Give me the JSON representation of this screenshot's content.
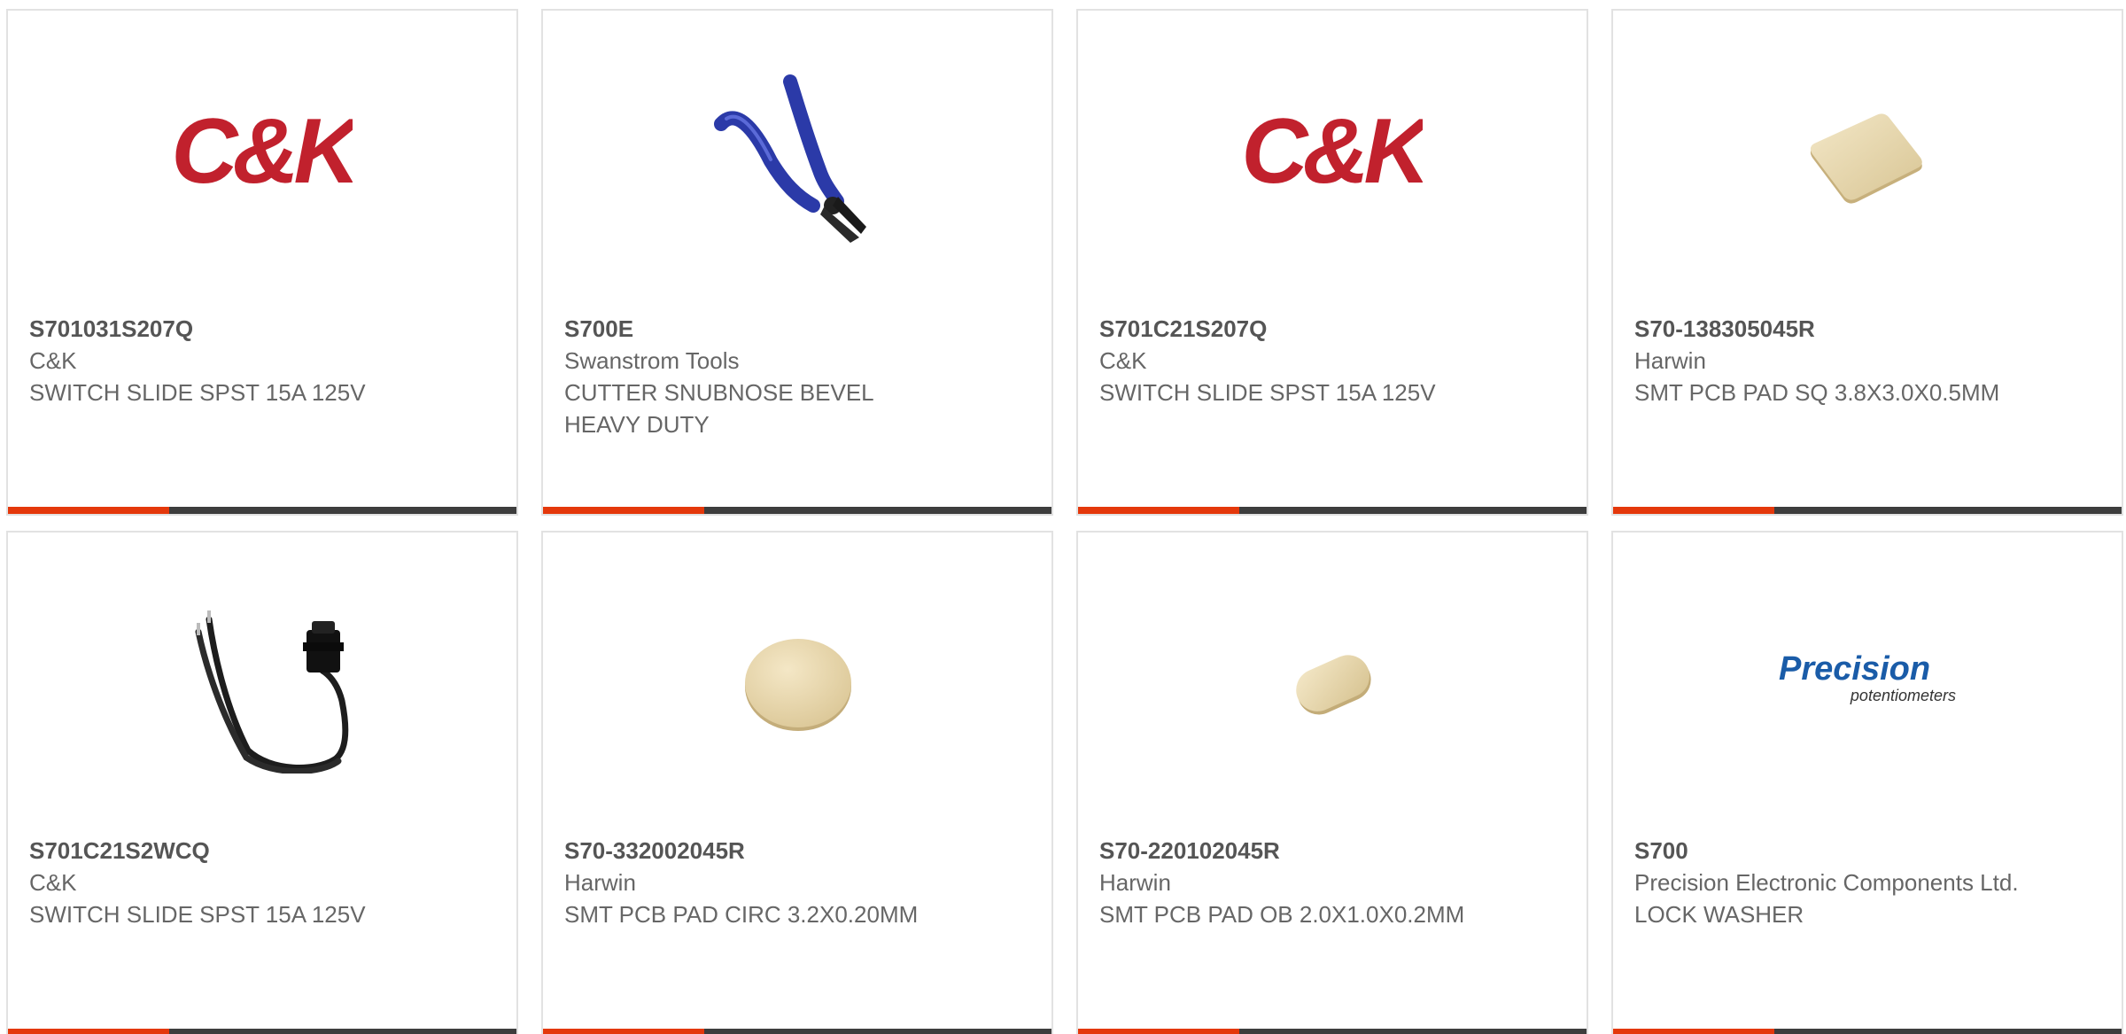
{
  "theme": {
    "accent": "#e4380b",
    "bar_dark": "#3d3d3d",
    "ck_red": "#c1212d",
    "precision_blue": "#1a5ca8"
  },
  "cards": [
    {
      "part_number": "S701031S207Q",
      "manufacturer": "C&K",
      "description": "SWITCH SLIDE SPST 15A 125V",
      "image_icon": "ck-logo-icon"
    },
    {
      "part_number": "S700E",
      "manufacturer": "Swanstrom Tools",
      "description": "CUTTER SNUBNOSE BEVEL HEAVY DUTY",
      "image_icon": "cutter-pliers-icon"
    },
    {
      "part_number": "S701C21S207Q",
      "manufacturer": "C&K",
      "description": "SWITCH SLIDE SPST 15A 125V",
      "image_icon": "ck-logo-icon"
    },
    {
      "part_number": "S70-138305045R",
      "manufacturer": "Harwin",
      "description": "SMT PCB PAD SQ 3.8X3.0X0.5MM",
      "image_icon": "square-pad-icon"
    },
    {
      "part_number": "S701C21S2WCQ",
      "manufacturer": "C&K",
      "description": "SWITCH SLIDE SPST 15A 125V",
      "image_icon": "wired-switch-icon"
    },
    {
      "part_number": "S70-332002045R",
      "manufacturer": "Harwin",
      "description": "SMT PCB PAD CIRC 3.2X0.20MM",
      "image_icon": "circular-pad-icon"
    },
    {
      "part_number": "S70-220102045R",
      "manufacturer": "Harwin",
      "description": "SMT PCB PAD OB 2.0X1.0X0.2MM",
      "image_icon": "oblong-pad-icon"
    },
    {
      "part_number": "S700",
      "manufacturer": "Precision Electronic Components Ltd.",
      "description": "LOCK WASHER",
      "image_icon": "precision-logo-icon",
      "logo_text": "Precision",
      "logo_subtext": "potentiometers"
    }
  ],
  "logos": {
    "ck": "C&K",
    "ck_mark": "®"
  }
}
